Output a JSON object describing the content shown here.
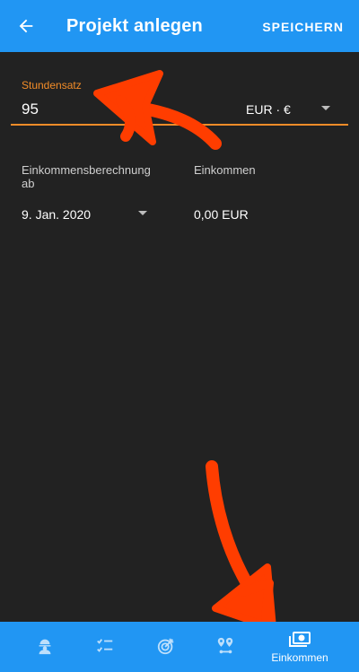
{
  "header": {
    "title": "Projekt anlegen",
    "save_label": "SPEICHERN"
  },
  "rate": {
    "label": "Stundensatz",
    "value": "95",
    "currency": "EUR · €"
  },
  "income": {
    "calc_label": "Einkommensberechnung ab",
    "calc_date": "9. Jan. 2020",
    "income_label": "Einkommen",
    "income_value": "0,00 EUR"
  },
  "colors": {
    "primary": "#2196f3",
    "accent": "#f28c28",
    "background": "#222222",
    "annotation": "#ff3d00"
  },
  "bottom_nav": {
    "items": [
      {
        "icon": "worker-icon",
        "label": ""
      },
      {
        "icon": "checklist-icon",
        "label": ""
      },
      {
        "icon": "target-icon",
        "label": ""
      },
      {
        "icon": "route-icon",
        "label": ""
      },
      {
        "icon": "money-icon",
        "label": "Einkommen",
        "active": true
      }
    ]
  }
}
